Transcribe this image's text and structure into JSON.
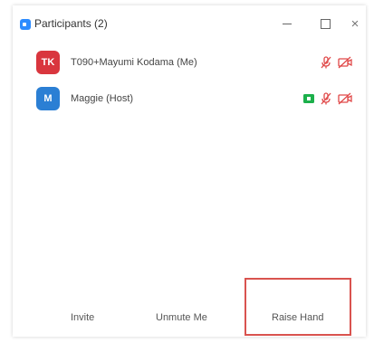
{
  "window": {
    "title": "Participants (2)",
    "controls": {
      "minimize": "minimize",
      "maximize": "maximize",
      "close": "×"
    }
  },
  "participants": [
    {
      "initials": "TK",
      "avatar_color": "#d9363e",
      "name": "T090+Mayumi Kodama (Me)",
      "video_on": false,
      "mic_muted": true,
      "camera_off": true
    },
    {
      "initials": "M",
      "avatar_color": "#2b7fd4",
      "name": "Maggie (Host)",
      "video_on": true,
      "mic_muted": true,
      "camera_off": true
    }
  ],
  "toolbar": {
    "invite_label": "Invite",
    "unmute_label": "Unmute Me",
    "raise_hand_label": "Raise Hand"
  },
  "colors": {
    "accent": "#2d8cff",
    "muted_red": "#e04848",
    "video_green": "#1cb04b",
    "highlight_red": "#d9534f"
  },
  "icons": {
    "app": "zoom-logo-icon",
    "mic_muted": "mic-muted-icon",
    "camera_off": "camera-off-icon",
    "video_on": "video-on-icon"
  }
}
